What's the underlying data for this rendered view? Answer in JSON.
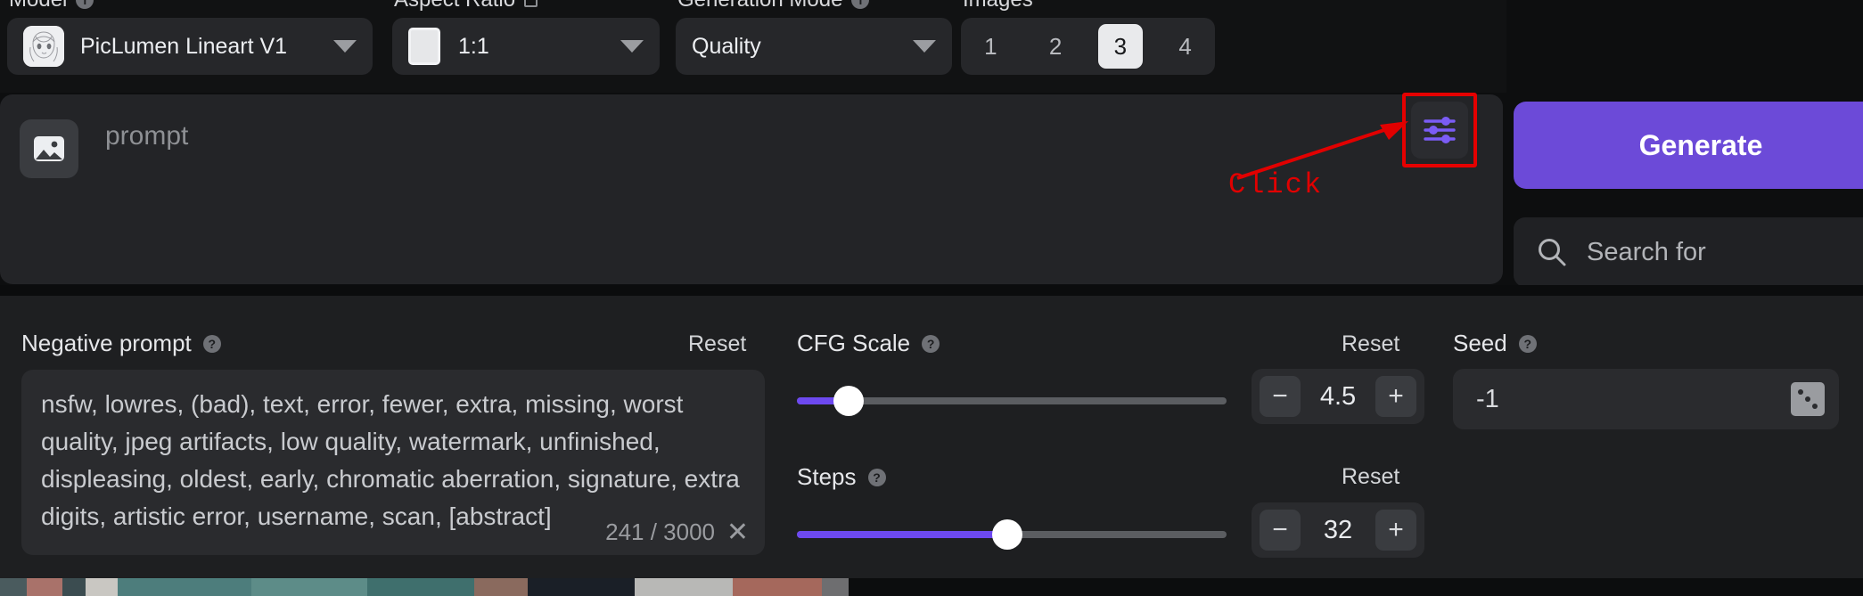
{
  "app": {
    "accent": "#6c4ad8",
    "panel_bg": "#1e1f21",
    "highlight": "#e60000"
  },
  "topbar": {
    "model": {
      "label": "Model",
      "value": "PicLumen Lineart V1",
      "icon": "model-avatar"
    },
    "aspect_ratio": {
      "label": "Aspect Ratio",
      "value": "1:1",
      "icon": "square-icon"
    },
    "generation_mode": {
      "label": "Generation Mode",
      "value": "Quality"
    },
    "images": {
      "label": "Images",
      "options": [
        "1",
        "2",
        "3",
        "4"
      ],
      "selected": "3"
    }
  },
  "prompt": {
    "placeholder": "prompt",
    "image_icon": "image-upload-icon",
    "settings_icon": "sliders-icon"
  },
  "annotation": {
    "text": "Click",
    "color": "#e10000"
  },
  "actions": {
    "generate_label": "Generate",
    "search_placeholder": "Search for",
    "search_icon": "search-icon"
  },
  "negative_prompt": {
    "label": "Negative prompt",
    "help": "?",
    "reset_label": "Reset",
    "value": "nsfw, lowres, (bad), text, error, fewer, extra, missing, worst quality, jpeg artifacts, low quality, watermark, unfinished, displeasing, oldest, early, chromatic aberration, signature, extra digits, artistic error, username, scan, [abstract]",
    "char_count": "241 / 3000",
    "clear_icon": "close-icon"
  },
  "cfg_scale": {
    "label": "CFG Scale",
    "help": "?",
    "reset_label": "Reset",
    "value": "4.5",
    "slider_percent": 12,
    "decrement": "−",
    "increment": "+"
  },
  "steps": {
    "label": "Steps",
    "help": "?",
    "reset_label": "Reset",
    "value": "32",
    "slider_percent": 49,
    "decrement": "−",
    "increment": "+"
  },
  "seed": {
    "label": "Seed",
    "help": "?",
    "value": "-1",
    "randomize_icon": "dice-icon"
  }
}
